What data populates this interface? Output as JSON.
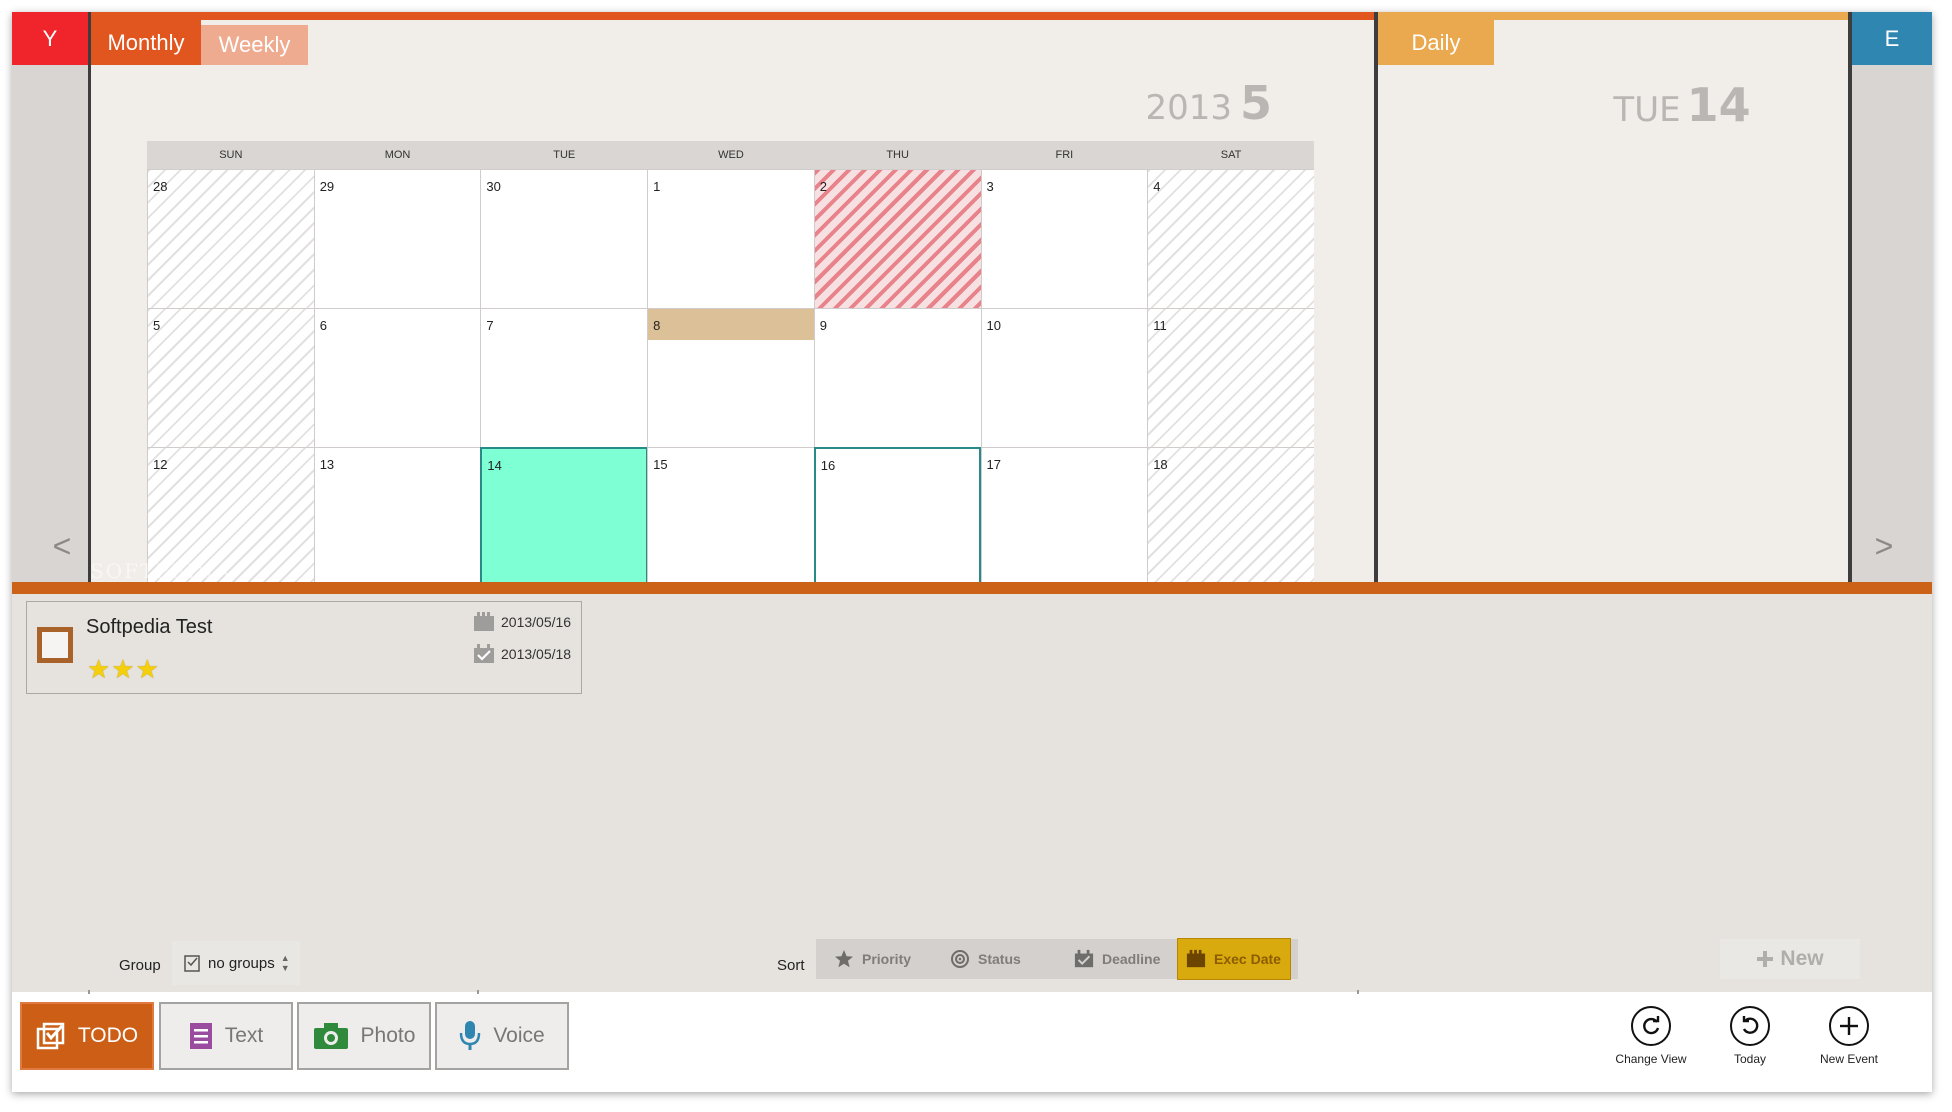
{
  "nav": {
    "year_tab": "Y",
    "right_tab": "E",
    "prev": "<",
    "next": ">"
  },
  "tabs": {
    "monthly": "Monthly",
    "weekly": "Weekly",
    "daily": "Daily"
  },
  "month_heading": {
    "year": "2013",
    "month": "5"
  },
  "day_heading": {
    "weekday": "TUE",
    "day": "14"
  },
  "calendar": {
    "weekdays": [
      "SUN",
      "MON",
      "TUE",
      "WED",
      "THU",
      "FRI",
      "SAT"
    ],
    "weeks": [
      [
        "28",
        "29",
        "30",
        "1",
        "2",
        "3",
        "4"
      ],
      [
        "5",
        "6",
        "7",
        "8",
        "9",
        "10",
        "11"
      ],
      [
        "12",
        "13",
        "14",
        "15",
        "16",
        "17",
        "18"
      ]
    ],
    "holiday": "2",
    "event_day": "8",
    "today": "14",
    "selected": "16"
  },
  "watermark": "SOFTPEDIA",
  "todo_item": {
    "title": "Softpedia Test",
    "stars": "★★★",
    "priority_stars": 3,
    "deadline": "2013/05/16",
    "exec_date": "2013/05/18"
  },
  "group": {
    "label": "Group",
    "value": "no groups"
  },
  "sort": {
    "label": "Sort",
    "options": [
      "Priority",
      "Status",
      "Deadline",
      "Exec Date"
    ],
    "active": "Exec Date"
  },
  "new_button": {
    "label": "New"
  },
  "bottom_tabs": {
    "todo": "TODO",
    "text": "Text",
    "photo": "Photo",
    "voice": "Voice"
  },
  "app_buttons": {
    "change_view": "Change View",
    "today": "Today",
    "new_event": "New Event"
  },
  "colors": {
    "monthly": "#e1551f",
    "daily": "#eaa84f",
    "year_tab": "#f0252b",
    "right_tab": "#2e86b1",
    "today_cell": "#7fffd4",
    "todo_tab": "#cc5f15",
    "exec_active": "#d9aa0d"
  }
}
